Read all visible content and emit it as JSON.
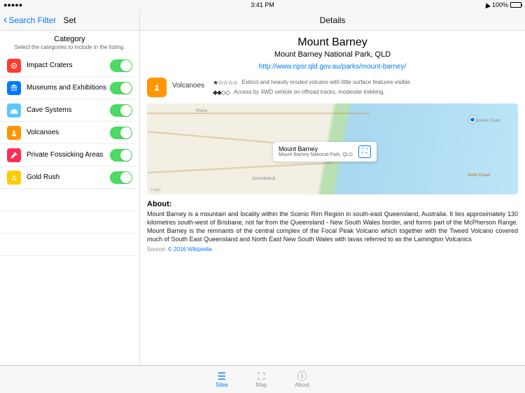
{
  "status": {
    "time": "3:41 PM",
    "battery": "100%"
  },
  "left": {
    "back": "Search Filter",
    "title": "Set",
    "cat_title": "Category",
    "cat_sub": "Select the categories to include in the listing.",
    "items": [
      {
        "label": "Impact Craters"
      },
      {
        "label": "Museums and Exhibitions"
      },
      {
        "label": "Cave Systems"
      },
      {
        "label": "Volcanoes"
      },
      {
        "label": "Private Fossicking Areas"
      },
      {
        "label": "Gold Rush"
      }
    ]
  },
  "right": {
    "title": "Details",
    "name": "Mount Barney",
    "park": "Mount Barney National Park, QLD",
    "url": "http://www.npsr.qld.gov.au/parks/mount-barney/",
    "type": "Volcanoes",
    "stars": "★☆☆☆☆",
    "rating_text": "Extinct and heavily eroded volcano with little surface features visible.",
    "diamonds": "◆◆◇◇",
    "access_text": "Access by 4WD vehicle on offroad tracks, moderate trekking.",
    "map_callout_title": "Mount Barney",
    "map_callout_sub": "Mount Barney National Park, QLD",
    "map_towns": {
      "roma": "Roma",
      "sunshine": "Sunshine Coast",
      "goondiwindi": "Goondiwindi",
      "goldcoast": "Gold Coast"
    },
    "map_legal": "Legal",
    "about_h": "About:",
    "about": "Mount Barney is a mountain and locality within the Scenic Rim Region in south-east Queensland, Australia. It lies approximately 130 kilometres south-west of Brisbane, not far from the Queensland - New South Wales border, and forms part of the McPherson Range. Mount Barney is the remnants of the central complex of the Focal Peak Volcano which together with the Tweed Volcano covered much of South East Queensland and North East New South Wales with lavas referred to as the Lamington Volcanics",
    "source_label": "Source:",
    "source_link": "© 2016 Wikipedia"
  },
  "tabs": {
    "sites": "Sites",
    "map": "Map",
    "about": "About"
  }
}
